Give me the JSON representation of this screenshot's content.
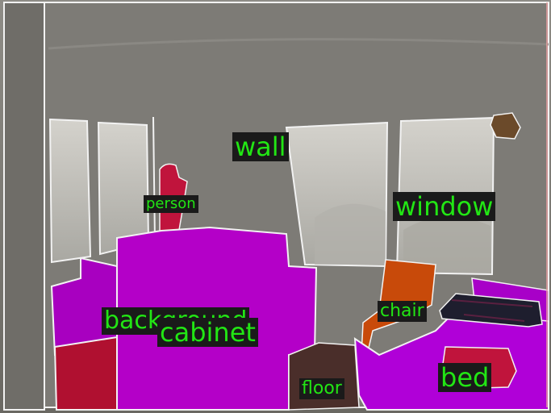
{
  "labels": {
    "wall": "wall",
    "person": "person",
    "window": "window",
    "chair": "chair",
    "background": "background",
    "cabinet": "cabinet",
    "floor": "floor",
    "bed": "bed"
  },
  "colors": {
    "wall": "#7a7873",
    "window": "#c8c6c0",
    "cabinet": "#b400c8",
    "background": "#a800c0",
    "person": "#c0143c",
    "chair": "#c84a0a",
    "floor": "#4a2e2a",
    "bed": "#b000d8",
    "label_text": "#22e614",
    "label_bg": "#1a1a1a"
  }
}
